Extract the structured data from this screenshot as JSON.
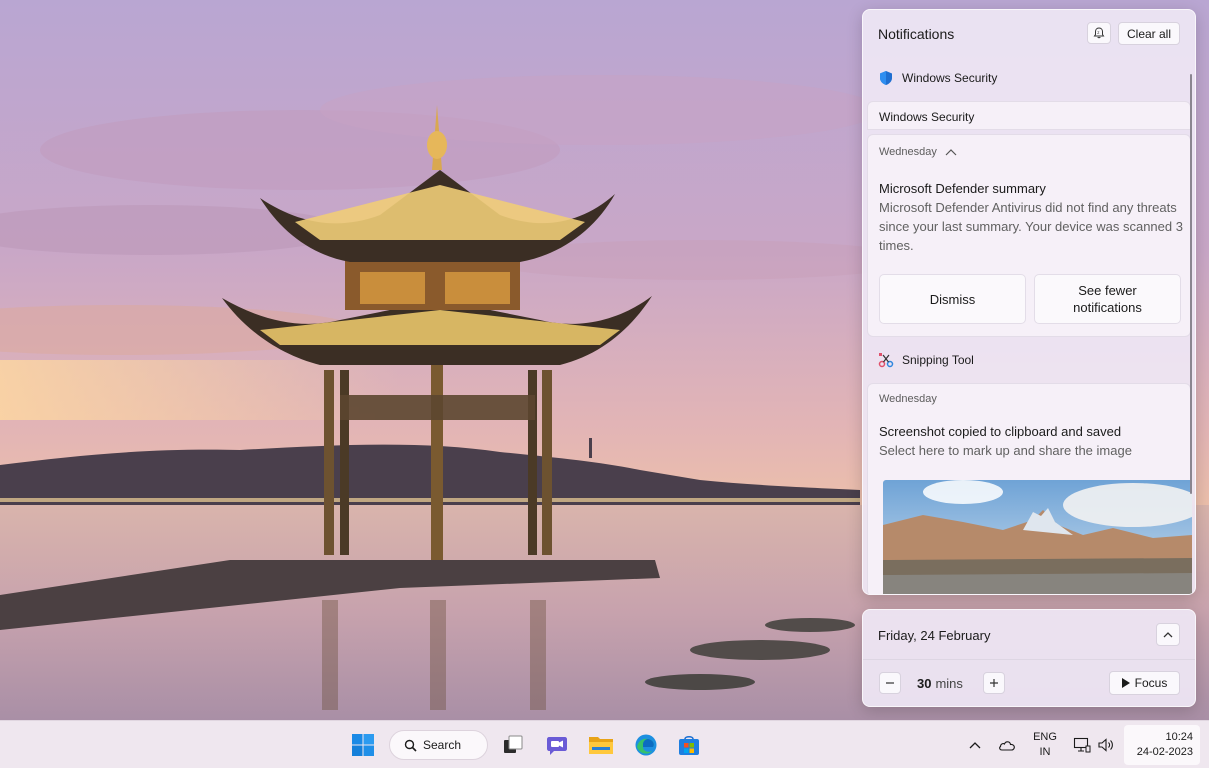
{
  "notifications": {
    "title": "Notifications",
    "clear_all_label": "Clear all",
    "groups": [
      {
        "app": "Windows Security",
        "collapsed_label": "Windows Security",
        "time": "Wednesday",
        "title": "Microsoft Defender summary",
        "body": "Microsoft Defender Antivirus did not find any threats since your last summary. Your device was scanned 3 times.",
        "actions": [
          "Dismiss",
          "See fewer notifications"
        ]
      },
      {
        "app": "Snipping Tool",
        "time": "Wednesday",
        "title": "Screenshot copied to clipboard and saved",
        "body": "Select here to mark up and share the image"
      }
    ]
  },
  "calendar": {
    "date": "Friday, 24 February",
    "focus_value": "30",
    "focus_unit": "mins",
    "focus_label": "Focus"
  },
  "taskbar": {
    "search_label": "Search",
    "apps": [
      "start-icon",
      "task-view-icon",
      "chat-icon",
      "file-explorer-icon",
      "edge-icon",
      "store-icon"
    ],
    "tray": {
      "lang_line1": "ENG",
      "lang_line2": "IN",
      "time": "10:24",
      "date": "24-02-2023"
    }
  },
  "colors": {
    "accent": "#0067c0",
    "panel_bg": "#eee6f4",
    "taskbar_bg": "#efe7ef"
  }
}
